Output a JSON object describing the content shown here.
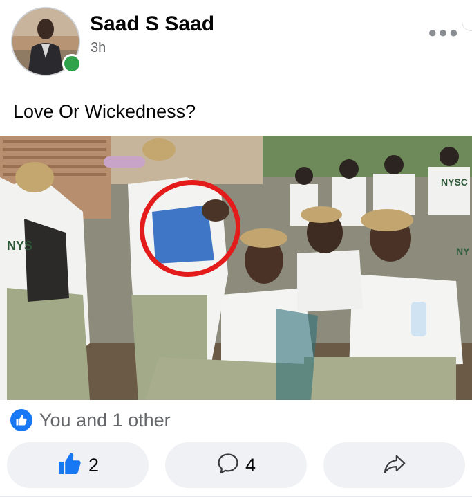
{
  "post": {
    "author": "Saad S Saad",
    "time": "3h",
    "caption": "Love Or Wickedness?",
    "more_icon": "more-options-icon",
    "online_color": "#31a24c"
  },
  "photo": {
    "overlay_text": {
      "shirt_left": "NYS",
      "shirt_right_top": "NYSC",
      "shirt_far_right": "NY"
    },
    "highlight_color": "#e31b1b"
  },
  "reactions": {
    "icon": "like-badge-icon",
    "summary": "You and 1 other"
  },
  "actions": {
    "like": {
      "icon": "thumbs-up-icon",
      "count": "2"
    },
    "comment": {
      "icon": "comment-bubble-icon",
      "count": "4"
    },
    "share": {
      "icon": "share-arrow-icon"
    }
  },
  "colors": {
    "brand_blue": "#1877f2",
    "secondary_text": "#65676b",
    "button_bg": "#eff1f4"
  }
}
